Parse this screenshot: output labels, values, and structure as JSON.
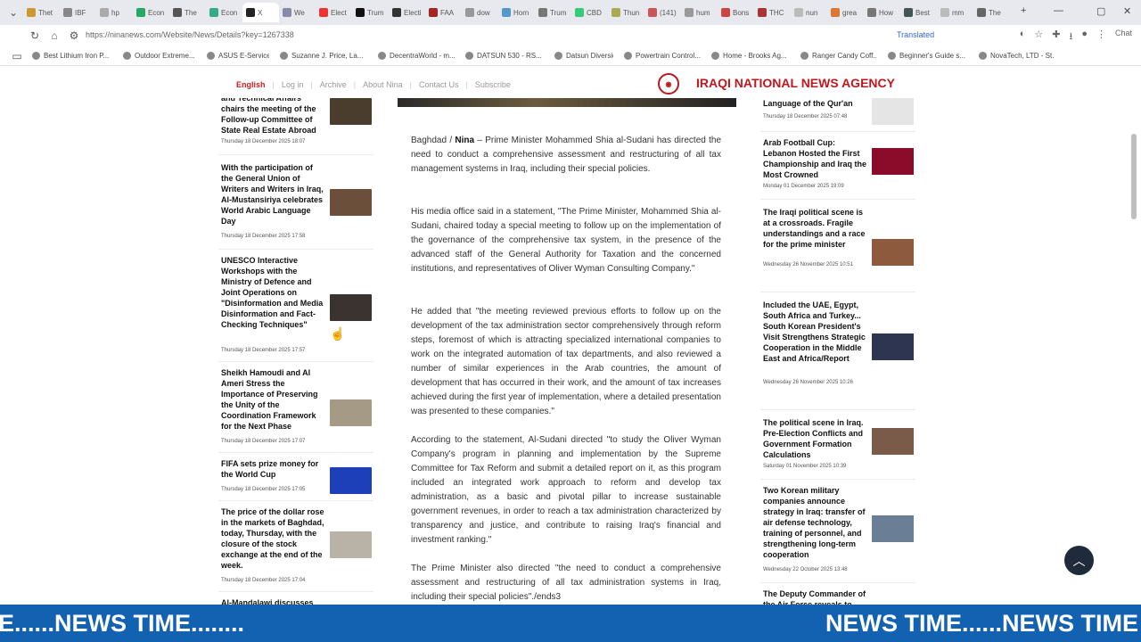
{
  "browser": {
    "tabs": [
      "Thet",
      "IBF",
      "hp",
      "Econ",
      "The",
      "Econ",
      "X",
      "We",
      "Elect",
      "Trum",
      "Electi",
      "FAA",
      "dow",
      "Horn",
      "Trum",
      "CBD",
      "Thun",
      "(141)",
      "hum",
      "Bons",
      "THC",
      "nun",
      "grea",
      "How",
      "Best",
      "mm",
      "The"
    ],
    "url": "https://ninanews.com/Website/News/Details?key=1267338",
    "translated_label": "Translated",
    "bookmarks": [
      "Best Lithium Iron P...",
      "Outdoor Extreme...",
      "ASUS E-Service",
      "Suzanne J. Price, La...",
      "DecentraWorld - m...",
      "DATSUN 530 - RS...",
      "Datsun Diversion",
      "Powertrain Control...",
      "Home - Brooks Ag...",
      "Ranger Candy Coff...",
      "Beginner's Guide s...",
      "NovaTech, LTD - St..."
    ],
    "chat_label": "Chat"
  },
  "site": {
    "nav": [
      "English",
      "Log in",
      "Archive",
      "About Nina",
      "Contact Us",
      "Subscribe"
    ],
    "brand": "IRAQI NATIONAL NEWS AGENCY"
  },
  "left_news": [
    {
      "title": "and Technical Affairs chairs the meeting of the Follow-up Committee of State Real Estate Abroad",
      "date": "Thursday 18 December 2025 18:07"
    },
    {
      "title": "With the participation of the General Union of Writers and Writers in Iraq, Al-Mustansiriya celebrates World Arabic Language Day",
      "date": "Thursday 18 December 2025 17:58"
    },
    {
      "title": "UNESCO Interactive Workshops with the Ministry of Defence and Joint Operations on \"Disinformation and Media Disinformation and Fact-Checking Techniques\"",
      "date": "Thursday 18 December 2025 17:57"
    },
    {
      "title": "Sheikh Hamoudi and Al Ameri Stress the Importance of Preserving the Unity of the Coordination Framework for the Next Phase",
      "date": "Thursday 18 December 2025 17:07"
    },
    {
      "title": "FIFA sets prize money for the World Cup",
      "date": "Thursday 18 December 2025 17:05"
    },
    {
      "title": "The price of the dollar rose in the markets of Baghdad, today, Thursday, with the closure of the stock exchange at the end of the week.",
      "date": "Thursday 18 December 2025 17:04"
    },
    {
      "title": "Al-Mandalawi discusses",
      "date": ""
    }
  ],
  "article": {
    "location": "Baghdad /",
    "agency": "Nina",
    "p1": "– Prime Minister Mohammed Shia al-Sudani has directed the need to conduct a comprehensive assessment and restructuring of all tax management systems in Iraq, including their special policies.",
    "p2": "His media office said in a statement, \"The Prime Minister, Mohammed Shia al-Sudani, chaired today a special meeting to follow up on the implementation of the governance of the comprehensive tax system, in the presence of the advanced staff of the General Authority for Taxation and the concerned institutions, and representatives of Oliver Wyman Consulting Company.\"",
    "p3": "He added that \"the meeting reviewed previous efforts to follow up on the development of the tax administration sector comprehensively through reform steps, foremost of which is attracting specialized international companies to work on the integrated automation of tax departments, and also reviewed a number of similar experiences in the Arab countries, the amount of development that has occurred in their work, and the amount of tax increases achieved during the first year of implementation, where a detailed presentation was presented to these companies.\"",
    "p4": "According to the statement, Al-Sudani directed \"to study the Oliver Wyman Company's program in planning and implementation by the Supreme Committee for Tax Reform and submit a detailed report on it, as this program included an integrated work approach to reform and develop tax administration, as a basic and pivotal pillar to increase sustainable government revenues, in order to reach a tax administration characterized by transparency and justice, and contribute to raising Iraq's financial and investment ranking.\"",
    "p5": "The Prime Minister also directed \"the need to conduct a comprehensive assessment and restructuring of all tax administration systems in Iraq, including their special policies\"./ends3"
  },
  "right_news": [
    {
      "title": "Language of the Qur'an",
      "date": "Thursday 18 December 2025 07:48"
    },
    {
      "title": "Arab Football Cup: Lebanon Hosted the First Championship and Iraq the Most Crowned",
      "date": "Monday 01 December 2025 19:09"
    },
    {
      "title": "The Iraqi political scene is at a crossroads. Fragile understandings and a race for the prime minister",
      "date": "Wednesday 26 November 2025 10:51"
    },
    {
      "title": "Included the UAE, Egypt, South Africa and Turkey... South Korean President's Visit Strengthens Strategic Cooperation in the Middle East and Africa/Report",
      "date": "Wednesday 26 November 2025 10:26"
    },
    {
      "title": "The political scene in Iraq. Pre-Election Conflicts and Government Formation Calculations",
      "date": "Saturday 01 November 2025 10:39"
    },
    {
      "title": "Two Korean military companies announce strategy in Iraq: transfer of air defense technology, training of personnel, and strengthening long-term cooperation",
      "date": "Wednesday 22 October 2025 13:48"
    },
    {
      "title": "The Deputy Commander of the Air Force reveals to",
      "date": ""
    }
  ],
  "ticker": {
    "text_left": "E......NEWS TIME........",
    "text_right": "NEWS TIME......NEWS TIME"
  },
  "colors": {
    "brand_red": "#c0181e",
    "ticker_blue": "#1362b1",
    "nav_red": "#d01f1f"
  }
}
